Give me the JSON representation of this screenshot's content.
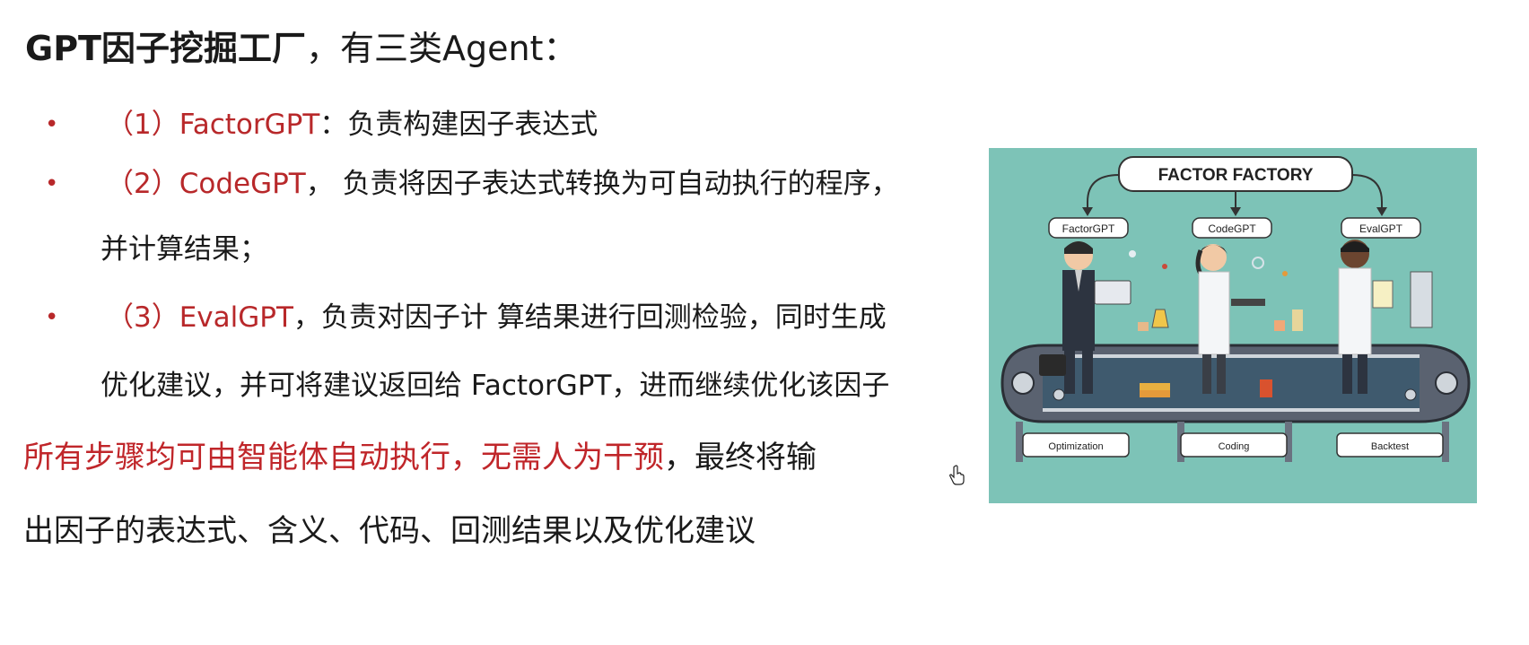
{
  "slide": {
    "title": {
      "bold": "GPT因子挖掘工厂",
      "rest": "，有三类Agent："
    },
    "bullets": [
      {
        "marker": "•",
        "label": "（1）FactorGPT",
        "text": "：负责构建因子表达式",
        "continuation": ""
      },
      {
        "marker": "•",
        "label": "（2）CodeGPT",
        "text": "， 负责将因子表达式转换为可自动执行的程序，",
        "continuation": "并计算结果；"
      },
      {
        "marker": "•",
        "label": "（3）EvalGPT",
        "text": "，负责对因子计 算结果进行回测检验，同时生成",
        "continuation": "优化建议，并可将建议返回给 FactorGPT，进而继续优化该因子"
      }
    ],
    "summary": {
      "highlight": "所有步骤均可由智能体自动执行，无需人为干预",
      "line1_rest": "，最终将输",
      "line2": "出因子的表达式、含义、代码、回测结果以及优化建议"
    }
  },
  "illustration": {
    "banner": "FACTOR FACTORY",
    "agents": [
      "FactorGPT",
      "CodeGPT",
      "EvalGPT"
    ],
    "stations": [
      "Optimization",
      "Coding",
      "Backtest"
    ],
    "colors": {
      "background": "#7dc3b7",
      "accent_red": "#b8282a"
    }
  }
}
